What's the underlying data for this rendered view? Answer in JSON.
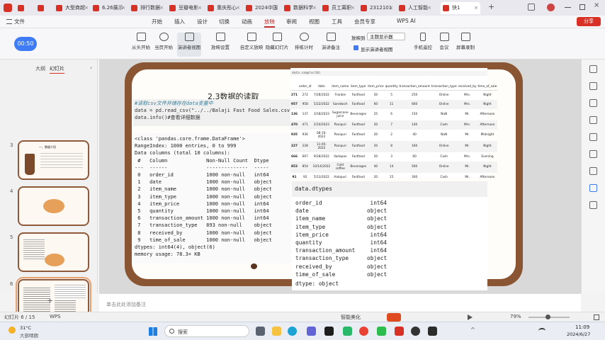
{
  "browser_tabs": [
    {
      "label": "",
      "color": "#d93025"
    },
    {
      "label": "",
      "color": "#d93025"
    },
    {
      "label": "大型商超",
      "color": "#d93025"
    },
    {
      "label": "6.26展示",
      "color": "#d93025"
    },
    {
      "label": "排行数据",
      "color": "#d93025"
    },
    {
      "label": "豆瓣电影",
      "color": "#d93025"
    },
    {
      "label": "重庆彤心",
      "color": "#d93025"
    },
    {
      "label": "2024中国",
      "color": "#d93025"
    },
    {
      "label": "数据科学",
      "color": "#d93025"
    },
    {
      "label": "员工离职",
      "color": "#d93025"
    },
    {
      "label": "2312101",
      "color": "#d93025"
    },
    {
      "label": "人工智能",
      "color": "#d93025"
    },
    {
      "label": "快1",
      "color": "#d93025"
    }
  ],
  "menus": [
    "文件",
    "开始",
    "插入",
    "设计",
    "切换",
    "动画",
    "放映",
    "审阅",
    "视图",
    "工具",
    "会员专享",
    "WPS AI"
  ],
  "active_menu": "放映",
  "share": "分享",
  "timer": "00:50",
  "ribbon": [
    "从头开始",
    "当页开始",
    "演讲者视图",
    "放映设置",
    "自定义放映",
    "隐藏幻灯片",
    "排练计时",
    "演讲备注",
    "放映到",
    "主题显示器",
    "显示演讲者视图",
    "手机遥控",
    "会议",
    "屏幕录制"
  ],
  "panel_tabs": {
    "outline": "大纲",
    "slides": "幻灯片"
  },
  "thumbs": [
    {
      "num": "3"
    },
    {
      "num": "4"
    },
    {
      "num": "5"
    },
    {
      "num": "6"
    },
    {
      "num": "7"
    }
  ],
  "thumb1_title": "一、数据介绍",
  "slide_title": "2.3数据的读取",
  "code_lines": [
    "#读取csv文件并储存在data变量中",
    "data = pd.read_csv(\"../../Balaji Fast Food Sales.csv\")",
    "data.info()#查看详细数据"
  ],
  "info_lines": [
    "<class 'pandas.core.frame.DataFrame'>",
    "RangeIndex: 1000 entries, 0 to 999",
    "Data columns (total 10 columns):",
    " #   Column             Non-Null Count  Dtype",
    "---  ------             --------------  -----",
    " 0   order_id           1000 non-null   int64",
    " 1   date               1000 non-null   object",
    " 2   item_name          1000 non-null   object",
    " 3   item_type          1000 non-null   object",
    " 4   item_price         1000 non-null   int64",
    " 5   quantity           1000 non-null   int64",
    " 6   transaction_amount 1000 non-null   int64",
    " 7   transaction_type   893 non-null    object",
    " 8   received_by        1000 non-null   object",
    " 9   time_of_sale       1000 non-null   object",
    "dtypes: int64(4), object(6)",
    "memory usage: 78.3+ KB"
  ],
  "df_code": "data.sample(10)",
  "df_columns": [
    "",
    "order_id",
    "date",
    "item_name",
    "item_type",
    "item_price",
    "quantity",
    "transaction_amount",
    "transaction_type",
    "received_by",
    "time_of_sale"
  ],
  "df_rows": [
    [
      "271",
      "272",
      "7/28/2022",
      "Frankie",
      "Fastfood",
      "50",
      "5",
      "250",
      "Online",
      "Mrs.",
      "Night"
    ],
    [
      "957",
      "958",
      "5/22/2022",
      "Sandwich",
      "Fastfood",
      "60",
      "11",
      "660",
      "Online",
      "Mrs.",
      "Night"
    ],
    [
      "136",
      "137",
      "3/18/2023",
      "Sugarcane juice",
      "Beverages",
      "25",
      "6",
      "150",
      "NaN",
      "Mr.",
      "Afternoon"
    ],
    [
      "470",
      "471",
      "2/10/2023",
      "Panipuri",
      "Fastfood",
      "20",
      "7",
      "140",
      "Cash",
      "Mrs.",
      "Afternoon"
    ],
    [
      "935",
      "936",
      "08-10-2022",
      "Panipuri",
      "Fastfood",
      "20",
      "2",
      "40",
      "NaN",
      "Mr.",
      "Midnight"
    ],
    [
      "227",
      "228",
      "11-05-2022",
      "Panipuri",
      "Fastfood",
      "20",
      "8",
      "160",
      "Online",
      "Mr.",
      "Night"
    ],
    [
      "666",
      "667",
      "9/28/2022",
      "Vadapav",
      "Fastfood",
      "20",
      "3",
      "60",
      "Cash",
      "Mrs.",
      "Evening"
    ],
    [
      "853",
      "854",
      "10/14/2022",
      "Cold coffee",
      "Beverages",
      "40",
      "14",
      "560",
      "Online",
      "Mr.",
      "Night"
    ],
    [
      "91",
      "92",
      "5/13/2022",
      "Aalopuri",
      "Fastfood",
      "20",
      "15",
      "300",
      "Cash",
      "Mr.",
      "Afternoon"
    ]
  ],
  "dtypes_header": "data.dtypes",
  "dtypes_rows": [
    {
      "name": "order_id",
      "type": "int64"
    },
    {
      "name": "date",
      "type": "object"
    },
    {
      "name": "item_name",
      "type": "object"
    },
    {
      "name": "item_type",
      "type": "object"
    },
    {
      "name": "item_price",
      "type": "int64"
    },
    {
      "name": "quantity",
      "type": "int64"
    },
    {
      "name": "transaction_amount",
      "type": "int64"
    },
    {
      "name": "transaction_type",
      "type": "object"
    },
    {
      "name": "received_by",
      "type": "object"
    },
    {
      "name": "time_of_sale",
      "type": "object"
    }
  ],
  "dtypes_footer": "dtype: object",
  "notes_placeholder": "单击此处添加备注",
  "status": {
    "slide_count": "幻灯片 6 / 15",
    "app": "WPS",
    "beautify": "智能美化",
    "zoom": "79%"
  },
  "taskbar": {
    "weather_temp": "31°C",
    "weather_desc": "大部晴朗",
    "search": "搜索",
    "time": "11:09",
    "date": "2024/6/27"
  }
}
